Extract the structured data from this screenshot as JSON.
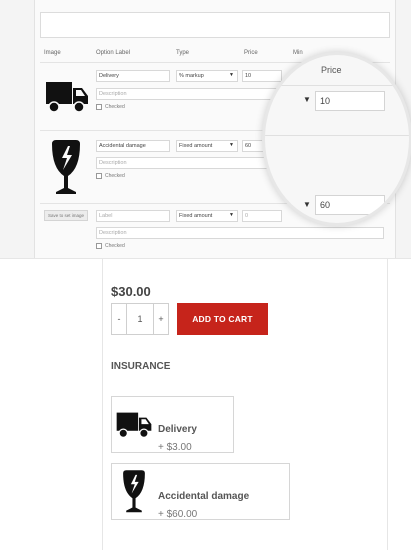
{
  "admin": {
    "headers": {
      "image": "Image",
      "option_label": "Option Label",
      "type": "Type",
      "price": "Price",
      "min": "Min"
    },
    "rows": [
      {
        "label": "Delivery",
        "type": "% markup",
        "price": "10",
        "description_placeholder": "Description",
        "checked_label": "Checked",
        "image_icon": "delivery-truck-icon"
      },
      {
        "label": "Accidental damage",
        "type": "Fixed amount",
        "price": "60",
        "description_placeholder": "Description",
        "checked_label": "Checked",
        "image_icon": "broken-glass-icon"
      },
      {
        "set_image_label": "Save to set image",
        "label_placeholder": "Label",
        "type": "Fixed amount",
        "price_placeholder": "0",
        "description_placeholder": "Description",
        "checked_label": "Checked"
      }
    ],
    "magnifier": {
      "header": "Price",
      "values": [
        "10",
        "60"
      ]
    }
  },
  "product": {
    "price": "$30.00",
    "quantity": "1",
    "minus": "-",
    "plus": "+",
    "add_to_cart": "ADD TO CART",
    "section_title": "INSURANCE",
    "options": [
      {
        "name": "Delivery",
        "price": "+ $3.00",
        "icon": "delivery-truck-icon"
      },
      {
        "name": "Accidental damage",
        "price": "+ $60.00",
        "icon": "broken-glass-icon"
      }
    ]
  },
  "colors": {
    "add_to_cart_bg": "#c6241b",
    "text": "#555555",
    "border": "#d6d6d6"
  }
}
